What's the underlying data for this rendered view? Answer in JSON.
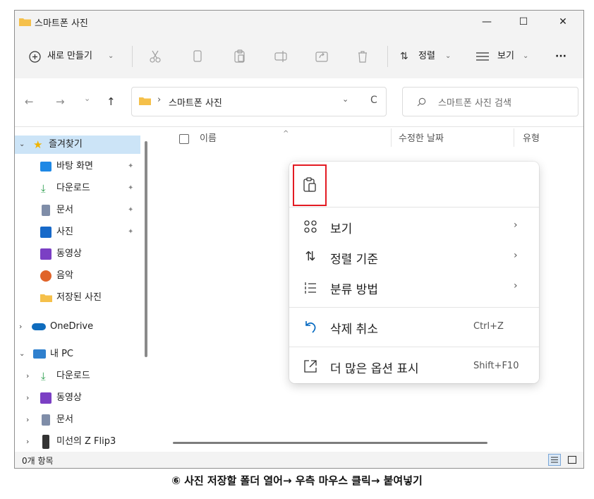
{
  "window": {
    "title": "스마트폰 사진",
    "controls": {
      "minimize": "—",
      "maximize": "☐",
      "close": "✕"
    }
  },
  "toolbar": {
    "new_label": "새로 만들기",
    "new_icon": "plus-circle-icon",
    "sort_label": "정렬",
    "view_label": "보기",
    "more": "···",
    "dropdown_glyph": "⌄",
    "icons": [
      "cut-icon",
      "copy-icon",
      "paste-icon",
      "rename-icon",
      "share-icon",
      "delete-icon"
    ]
  },
  "address": {
    "path": "스마트폰 사진",
    "separator": "›",
    "search_placeholder": "스마트폰 사진 검색",
    "back": "←",
    "forward": "→",
    "recent": "⌄",
    "up": "↑",
    "refresh": "C",
    "chevron": "⌄"
  },
  "sidebar": {
    "quick_access": "즐겨찾기",
    "items": [
      {
        "label": "바탕 화면",
        "icon": "desktop-icon",
        "color": "#1e88e5",
        "pinned": true
      },
      {
        "label": "다운로드",
        "icon": "download-icon",
        "color": "#2e9f4f",
        "pinned": true
      },
      {
        "label": "문서",
        "icon": "document-icon",
        "color": "#7f8da8",
        "pinned": true
      },
      {
        "label": "사진",
        "icon": "photo-icon",
        "color": "#1769c9",
        "pinned": true
      },
      {
        "label": "동영상",
        "icon": "video-icon",
        "color": "#7b3fc4",
        "pinned": false
      },
      {
        "label": "음악",
        "icon": "music-icon",
        "color": "#e0642a",
        "pinned": false
      },
      {
        "label": "저장된 사진",
        "icon": "folder-icon",
        "color": "#f5c04a",
        "pinned": false
      }
    ],
    "onedrive": "OneDrive",
    "this_pc": "내 PC",
    "pc_items": [
      {
        "label": "다운로드",
        "icon": "download-icon",
        "color": "#2e9f4f"
      },
      {
        "label": "동영상",
        "icon": "video-icon",
        "color": "#7b3fc4"
      },
      {
        "label": "문서",
        "icon": "document-icon",
        "color": "#7f8da8"
      },
      {
        "label": "미선의 Z Flip3",
        "icon": "phone-icon",
        "color": "#333333"
      }
    ]
  },
  "columns": {
    "name": "이름",
    "modified": "수정한 날짜",
    "type": "유형"
  },
  "context_menu": {
    "items": [
      {
        "label": "보기",
        "icon": "grid-icon",
        "has_submenu": true
      },
      {
        "label": "정렬 기준",
        "icon": "sort-icon",
        "has_submenu": true
      },
      {
        "label": "분류 방법",
        "icon": "group-icon",
        "has_submenu": true
      },
      {
        "label": "삭제 취소",
        "icon": "undo-icon",
        "shortcut": "Ctrl+Z"
      },
      {
        "label": "더 많은 옵션 표시",
        "icon": "more-options-icon",
        "shortcut": "Shift+F10"
      }
    ],
    "submenu_arrow": "›",
    "paste_icon": "paste-icon"
  },
  "status": {
    "count": "0개 항목"
  },
  "caption": "⑥ 사진 저장할 폴더 열어→ 우측 마우스 클릭→ 붙여넣기",
  "colors": {
    "accent": "#0067c0",
    "highlight_box": "#e31b23",
    "selection": "#cce4f7",
    "folder": "#f5c04a"
  }
}
